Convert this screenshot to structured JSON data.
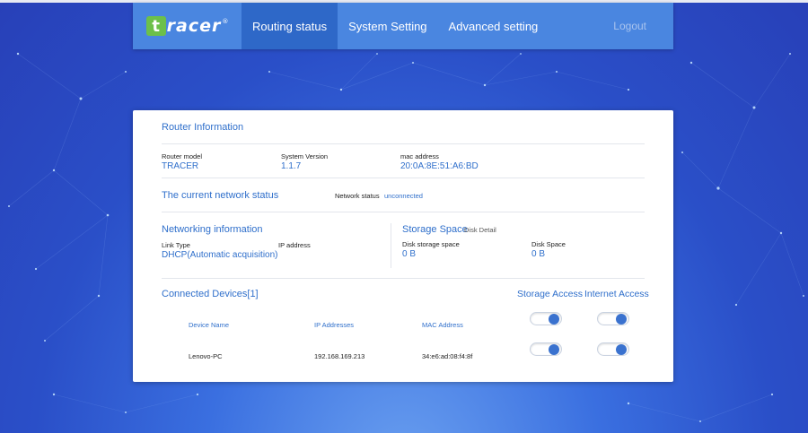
{
  "brand": {
    "logo_letter": "t",
    "logo_text": "racer",
    "logo_mark": "®",
    "logo_color": "#6cc04a"
  },
  "nav": {
    "items": [
      {
        "label": "Routing status",
        "active": true
      },
      {
        "label": "System Setting",
        "active": false
      },
      {
        "label": "Advanced setting",
        "active": false
      }
    ],
    "logout": "Logout"
  },
  "router_info": {
    "title": "Router Information",
    "model_label": "Router model",
    "model_value": "TRACER",
    "version_label": "System Version",
    "version_value": "1.1.7",
    "mac_label": "mac address",
    "mac_value": "20:0A:8E:51:A6:BD"
  },
  "network_status": {
    "title": "The current network status",
    "status_label": "Network status",
    "status_value": "unconnected"
  },
  "networking": {
    "title": "Networking information",
    "link_type_label": "Link Type",
    "link_type_value": "DHCP(Automatic acquisition)",
    "ip_label": "IP address",
    "ip_value": ""
  },
  "storage": {
    "title": "Storage Space",
    "detail_link": "Disk Detail",
    "disk_storage_label": "Disk storage space",
    "disk_storage_value": "0 B",
    "disk_space_label": "Disk Space",
    "disk_space_value": "0 B"
  },
  "devices": {
    "title": "Connected Devices[1]",
    "storage_access_header": "Storage Access",
    "internet_access_header": "Internet Access",
    "columns": [
      "Device Name",
      "IP Addresses",
      "MAC Address"
    ],
    "rows": [
      {
        "name": "Lenovo-PC",
        "ip": "192.168.169.213",
        "mac": "34:e6:ad:08:f4:8f",
        "storage_access": true,
        "internet_access": true
      }
    ],
    "header_storage_access": true,
    "header_internet_access": true
  },
  "colors": {
    "accent": "#2f6fcb",
    "nav_bg": "#4a86e0",
    "nav_active": "#2e68c8"
  }
}
